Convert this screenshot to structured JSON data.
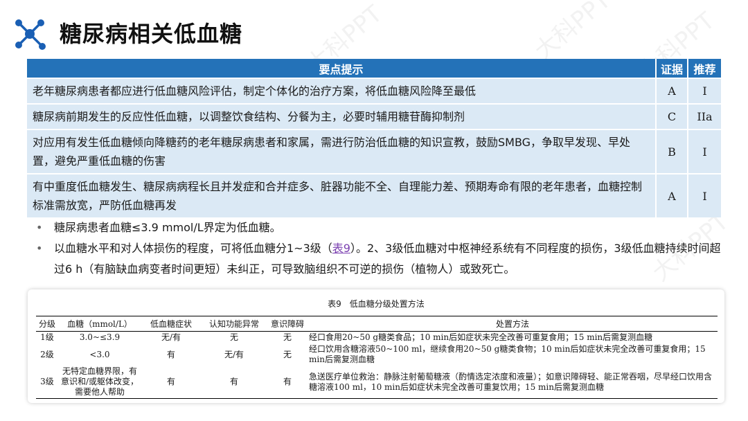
{
  "title": "糖尿病相关低血糖",
  "watermark": "大科PPT",
  "table": {
    "headers": [
      "要点提示",
      "证据",
      "推荐"
    ],
    "rows": [
      {
        "text": "老年糖尿病患者都应进行低血糖风险评估，制定个体化的治疗方案，将低血糖风险降至最低",
        "evidence": "A",
        "rec": "I"
      },
      {
        "text": "糖尿病前期发生的反应性低血糖，以调整饮食结构、分餐为主，必要时辅用糖苷酶抑制剂",
        "evidence": "C",
        "rec": "IIa"
      },
      {
        "text": "对应用有发生低血糖倾向降糖药的老年糖尿病患者和家属，需进行防治低血糖的知识宣教，鼓励SMBG，争取早发现、早处置，避免严重低血糖的伤害",
        "evidence": "B",
        "rec": "I"
      },
      {
        "text": "有中重度低血糖发生、糖尿病病程长且并发症和合并症多、脏器功能不全、自理能力差、预期寿命有限的老年患者，血糖控制标准需放宽，严防低血糖再发",
        "evidence": "A",
        "rec": "I"
      }
    ]
  },
  "bullets": {
    "b1": "糖尿病患者血糖≤3.9 mmol/L界定为低血糖。",
    "b2_pre": "以血糖水平和对人体损伤的程度，可将低血糖分1~3级（",
    "b2_link": "表9",
    "b2_post": "）。2、3级低血糖对中枢神经系统有不同程度的损伤，3级低血糖持续时间超过6 h（有脑缺血病变者时间更短）未纠正，可导致脑组织不可逆的损伤（植物人）或致死亡。"
  },
  "table9": {
    "caption": "表9　低血糖分级处置方法",
    "headers": [
      "分级",
      "血糖（mmol/L）",
      "低血糖症状",
      "认知功能异常",
      "意识障碍",
      "处置方法"
    ],
    "rows": [
      {
        "grade": "1级",
        "glucose": "3.0~≤3.9",
        "symptom": "无/有",
        "cognitive": "无",
        "conscious": "无",
        "treatment": "经口食用20~50 g糖类食品；10 min后如症状未完全改善可重复食用；15 min后需复测血糖"
      },
      {
        "grade": "2级",
        "glucose": "<3.0",
        "symptom": "有",
        "cognitive": "无/有",
        "conscious": "无",
        "treatment": "经口饮用含糖溶液50~100 ml，继续食用20~50 g糖类食物；10 min后如症状未完全改善可重复食用；15 min后需复测血糖"
      },
      {
        "grade": "3级",
        "glucose": "无特定血糖界限，有意识和/或躯体改变，需要他人帮助",
        "symptom": "有",
        "cognitive": "有",
        "conscious": "有",
        "treatment": "急送医疗单位救治：静脉注射葡萄糖液（酌情选定浓度和液量）；如意识障碍轻、能正常吞咽，尽早经口饮用含糖溶液100 ml，10 min后如症状未完全改善可重复饮用；15 min后需复测血糖"
      }
    ]
  },
  "colors": {
    "header": "#2472b8",
    "row": "#dbe9f5",
    "logo": "#1a5fb4"
  }
}
